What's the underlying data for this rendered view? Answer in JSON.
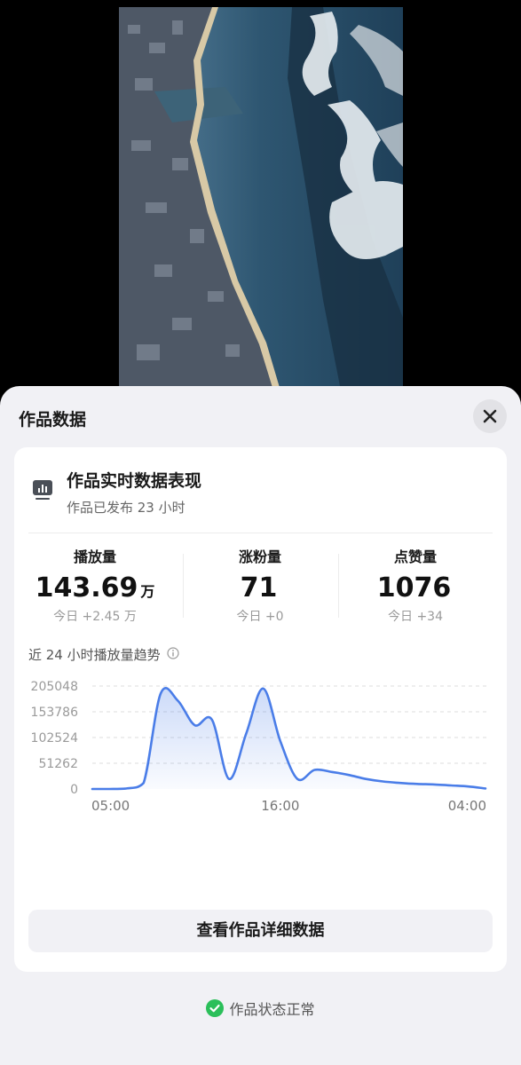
{
  "video": {
    "icon": "tsunami-aerial-photo"
  },
  "sheet": {
    "title": "作品数据",
    "close_icon": "close-icon"
  },
  "card": {
    "icon": "bar-chart-icon",
    "heading": "作品实时数据表现",
    "subtitle": "作品已发布 23 小时"
  },
  "metrics": [
    {
      "label": "播放量",
      "value": "143.69",
      "unit": "万",
      "delta": "今日 +2.45 万"
    },
    {
      "label": "涨粉量",
      "value": "71",
      "unit": "",
      "delta": "今日 +0"
    },
    {
      "label": "点赞量",
      "value": "1076",
      "unit": "",
      "delta": "今日 +34"
    }
  ],
  "trend": {
    "title": "近 24 小时播放量趋势",
    "info_icon": "info-icon"
  },
  "chart_data": {
    "type": "area",
    "title": "近 24 小时播放量趋势",
    "xlabel": "",
    "ylabel": "",
    "x_tick_labels": [
      "05:00",
      "16:00",
      "04:00"
    ],
    "y_tick_labels": [
      "205048",
      "153786",
      "102524",
      "51262",
      "0"
    ],
    "y_ticks": [
      205048,
      153786,
      102524,
      51262,
      0
    ],
    "ylim": [
      0,
      205048
    ],
    "grid": true,
    "color": "#4a7de8",
    "x": [
      "05:00",
      "06:00",
      "07:00",
      "08:00",
      "09:00",
      "10:00",
      "11:00",
      "12:00",
      "13:00",
      "14:00",
      "15:00",
      "16:00",
      "17:00",
      "18:00",
      "19:00",
      "20:00",
      "21:00",
      "22:00",
      "23:00",
      "00:00",
      "01:00",
      "02:00",
      "03:00",
      "04:00"
    ],
    "values": [
      0,
      0,
      1000,
      12000,
      190000,
      176000,
      127000,
      138000,
      20000,
      110000,
      200000,
      95000,
      20000,
      38000,
      34000,
      28000,
      20000,
      15000,
      12000,
      10000,
      9000,
      7000,
      5000,
      1000
    ]
  },
  "detail_button": {
    "label": "查看作品详细数据"
  },
  "status": {
    "icon": "check-circle-icon",
    "text": "作品状态正常",
    "color": "#2bbf5a"
  }
}
